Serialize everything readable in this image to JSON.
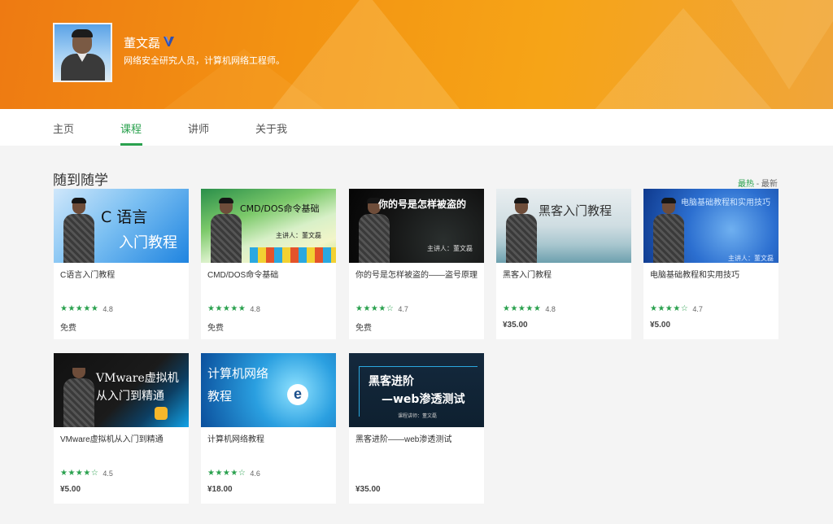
{
  "profile": {
    "name": "董文磊",
    "description": "网络安全研究人员，计算机网络工程师。"
  },
  "nav": {
    "items": [
      {
        "label": "主页",
        "active": false
      },
      {
        "label": "课程",
        "active": true
      },
      {
        "label": "讲师",
        "active": false
      },
      {
        "label": "关于我",
        "active": false
      }
    ]
  },
  "section": {
    "title": "随到随学",
    "sort_hot": "最热",
    "sort_sep": " - ",
    "sort_new": "最新"
  },
  "colors": {
    "accent": "#2aa14e",
    "banner": "#f39312"
  },
  "courses": [
    {
      "title": "C语言入门教程",
      "stars": "★★★★★",
      "rating": "4.8",
      "price": "免费",
      "thumb_line1": "C 语言",
      "thumb_line2": "入门教程",
      "thumb_sub": ""
    },
    {
      "title": "CMD/DOS命令基础",
      "stars": "★★★★★",
      "rating": "4.8",
      "price": "免费",
      "thumb_line1": "CMD/DOS命令基础",
      "thumb_line2": "",
      "thumb_sub": "主讲人：董文磊"
    },
    {
      "title": "你的号是怎样被盗的——盗号原理",
      "stars": "★★★★☆",
      "rating": "4.7",
      "price": "免费",
      "thumb_line1": "你的号是怎样被盗的",
      "thumb_line2": "",
      "thumb_sub": "主讲人：董文磊"
    },
    {
      "title": "黑客入门教程",
      "stars": "★★★★★",
      "rating": "4.8",
      "price": "¥35.00",
      "thumb_line1": "黑客入门教程",
      "thumb_line2": "",
      "thumb_sub": ""
    },
    {
      "title": "电脑基础教程和实用技巧",
      "stars": "★★★★☆",
      "rating": "4.7",
      "price": "¥5.00",
      "thumb_line1": "电脑基础教程和实用技巧",
      "thumb_line2": "",
      "thumb_sub": "主讲人：董文磊"
    },
    {
      "title": "VMware虚拟机从入门到精通",
      "stars": "★★★★☆",
      "rating": "4.5",
      "price": "¥5.00",
      "thumb_line1": "VMware虚拟机",
      "thumb_line2": "从入门到精通",
      "thumb_sub": ""
    },
    {
      "title": "计算机网络教程",
      "stars": "★★★★☆",
      "rating": "4.6",
      "price": "¥18.00",
      "thumb_line1": "计算机网络",
      "thumb_line2": "教程",
      "thumb_sub": ""
    },
    {
      "title": "黑客进阶——web渗透测试",
      "stars": "",
      "rating": "",
      "price": "¥35.00",
      "thumb_line1": "黑客进阶",
      "thumb_line2": "—web渗透测试",
      "thumb_sub": "课程讲师：董文磊"
    }
  ]
}
